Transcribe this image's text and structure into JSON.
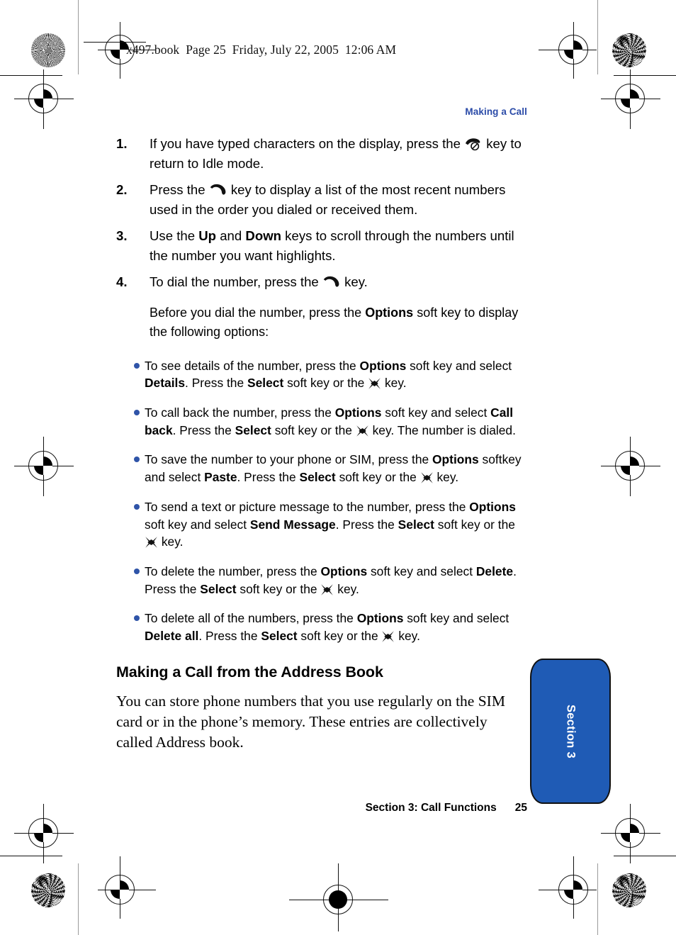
{
  "print_header": {
    "text": "x497.book  Page 25  Friday, July 22, 2005  12:06 AM"
  },
  "running_head": {
    "label": "Making a Call",
    "color": "#2b4ba8"
  },
  "steps": [
    {
      "number": "1.",
      "segments": [
        {
          "text": "If you have typed characters on the display, press the ",
          "bold": false
        },
        {
          "icon": "end-call-key-icon"
        },
        {
          "text": " key to return to Idle mode.",
          "bold": false
        }
      ]
    },
    {
      "number": "2.",
      "segments": [
        {
          "text": "Press the ",
          "bold": false
        },
        {
          "icon": "send-call-key-icon"
        },
        {
          "text": " key to display a list of the most recent numbers used in the order you dialed or received them.",
          "bold": false
        }
      ]
    },
    {
      "number": "3.",
      "segments": [
        {
          "text": "Use the ",
          "bold": false
        },
        {
          "text": "Up",
          "bold": true
        },
        {
          "text": " and ",
          "bold": false
        },
        {
          "text": "Down",
          "bold": true
        },
        {
          "text": " keys to scroll through the numbers until the number you want highlights.",
          "bold": false
        }
      ]
    },
    {
      "number": "4.",
      "segments": [
        {
          "text": "To dial the number, press the ",
          "bold": false
        },
        {
          "icon": "send-call-key-icon"
        },
        {
          "text": " key.",
          "bold": false
        }
      ]
    }
  ],
  "substep": {
    "segments": [
      {
        "text": "Before you dial the number, press the ",
        "bold": false
      },
      {
        "text": "Options",
        "bold": true
      },
      {
        "text": " soft key to display the following options:",
        "bold": false
      }
    ]
  },
  "bullets": [
    {
      "bullet_color": "#2f54a8",
      "segments": [
        {
          "text": " To see details of the number, press the ",
          "bold": false
        },
        {
          "text": "Options",
          "bold": true
        },
        {
          "text": " soft key and select ",
          "bold": false
        },
        {
          "text": "Details",
          "bold": true
        },
        {
          "text": ". Press the ",
          "bold": false
        },
        {
          "text": "Select",
          "bold": true
        },
        {
          "text": " soft key or the ",
          "bold": false
        },
        {
          "icon": "navigation-ok-key-icon"
        },
        {
          "text": " key.",
          "bold": false
        }
      ]
    },
    {
      "bullet_color": "#2f54a8",
      "segments": [
        {
          "text": "To call back the number, press the ",
          "bold": false
        },
        {
          "text": "Options",
          "bold": true
        },
        {
          "text": " soft key and select ",
          "bold": false
        },
        {
          "text": "Call back",
          "bold": true
        },
        {
          "text": ". Press the ",
          "bold": false
        },
        {
          "text": "Select",
          "bold": true
        },
        {
          "text": " soft key or the ",
          "bold": false
        },
        {
          "icon": "navigation-ok-key-icon"
        },
        {
          "text": " key. The number is dialed.",
          "bold": false
        }
      ]
    },
    {
      "bullet_color": "#2f54a8",
      "segments": [
        {
          "text": " To save the number to your phone or SIM, press the ",
          "bold": false
        },
        {
          "text": "Options",
          "bold": true
        },
        {
          "text": " softkey and select ",
          "bold": false
        },
        {
          "text": "Paste",
          "bold": true
        },
        {
          "text": ". Press the ",
          "bold": false
        },
        {
          "text": "Select",
          "bold": true
        },
        {
          "text": " soft key or the ",
          "bold": false
        },
        {
          "icon": "navigation-ok-key-icon"
        },
        {
          "text": " key.",
          "bold": false
        }
      ]
    },
    {
      "bullet_color": "#2f54a8",
      "segments": [
        {
          "text": "To send a text or picture message to the number, press the ",
          "bold": false
        },
        {
          "text": "Options",
          "bold": true
        },
        {
          "text": " soft key and select ",
          "bold": false
        },
        {
          "text": "Send Message",
          "bold": true
        },
        {
          "text": ". Press the ",
          "bold": false
        },
        {
          "text": "Select",
          "bold": true
        },
        {
          "text": " soft key or the ",
          "bold": false
        },
        {
          "icon": "navigation-ok-key-icon"
        },
        {
          "text": " key.",
          "bold": false
        }
      ]
    },
    {
      "bullet_color": "#2f54a8",
      "segments": [
        {
          "text": "To delete the number, press the ",
          "bold": false
        },
        {
          "text": "Options",
          "bold": true
        },
        {
          "text": " soft key and select ",
          "bold": false
        },
        {
          "text": "Delete",
          "bold": true
        },
        {
          "text": ". Press the ",
          "bold": false
        },
        {
          "text": "Select",
          "bold": true
        },
        {
          "text": " soft key or the ",
          "bold": false
        },
        {
          "icon": "navigation-ok-key-icon"
        },
        {
          "text": " key.",
          "bold": false
        }
      ]
    },
    {
      "bullet_color": "#2f54a8",
      "segments": [
        {
          "text": "To delete all of the numbers, press the ",
          "bold": false
        },
        {
          "text": "Options",
          "bold": true
        },
        {
          "text": " soft key and select ",
          "bold": false
        },
        {
          "text": "Delete all",
          "bold": true
        },
        {
          "text": ". Press the ",
          "bold": false
        },
        {
          "text": "Select",
          "bold": true
        },
        {
          "text": " soft key or the ",
          "bold": false
        },
        {
          "icon": "navigation-ok-key-icon"
        },
        {
          "text": " key.",
          "bold": false
        }
      ]
    }
  ],
  "section_heading": "Making a Call from the Address Book",
  "section_body": "You can store phone numbers that you use regularly on the SIM card or in the phone’s memory. These entries are collectively called Address book.",
  "footer": {
    "title": "Section 3: Call Functions",
    "page_number": "25"
  },
  "side_tab": {
    "label": "Section 3",
    "background": "#1f5bb5",
    "text_color": "#ffffff"
  }
}
